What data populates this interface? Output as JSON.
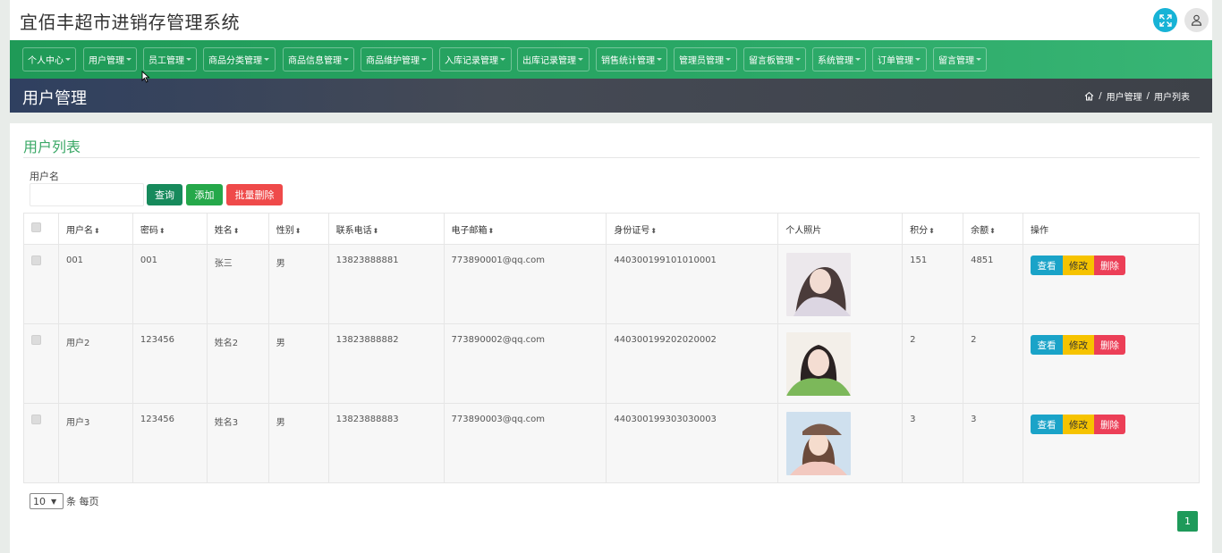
{
  "app": {
    "title": "宜佰丰超市进销存管理系统"
  },
  "nav": [
    {
      "label": "个人中心"
    },
    {
      "label": "用户管理"
    },
    {
      "label": "员工管理"
    },
    {
      "label": "商品分类管理"
    },
    {
      "label": "商品信息管理"
    },
    {
      "label": "商品维护管理"
    },
    {
      "label": "入库记录管理"
    },
    {
      "label": "出库记录管理"
    },
    {
      "label": "销售统计管理"
    },
    {
      "label": "管理员管理"
    },
    {
      "label": "留言板管理"
    },
    {
      "label": "系统管理"
    },
    {
      "label": "订单管理"
    },
    {
      "label": "留言管理"
    }
  ],
  "banner": {
    "title": "用户管理",
    "crumb1": "用户管理",
    "crumb2": "用户列表",
    "sep": "/"
  },
  "panel": {
    "title": "用户列表"
  },
  "search": {
    "label": "用户名",
    "value": "",
    "placeholder": "",
    "query_btn": "查询",
    "add_btn": "添加",
    "batch_delete_btn": "批量删除"
  },
  "table": {
    "headers": {
      "username": "用户名",
      "password": "密码",
      "name": "姓名",
      "gender": "性别",
      "phone": "联系电话",
      "email": "电子邮箱",
      "idcard": "身份证号",
      "photo": "个人照片",
      "points": "积分",
      "balance": "余额",
      "action": "操作"
    },
    "rows": [
      {
        "username": "001",
        "password": "001",
        "name": "张三",
        "gender": "男",
        "phone": "13823888881",
        "email": "773890001@qq.com",
        "idcard": "440300199101010001",
        "points": "151",
        "balance": "4851"
      },
      {
        "username": "用户2",
        "password": "123456",
        "name": "姓名2",
        "gender": "男",
        "phone": "13823888882",
        "email": "773890002@qq.com",
        "idcard": "440300199202020002",
        "points": "2",
        "balance": "2"
      },
      {
        "username": "用户3",
        "password": "123456",
        "name": "姓名3",
        "gender": "男",
        "phone": "13823888883",
        "email": "773890003@qq.com",
        "idcard": "440300199303030003",
        "points": "3",
        "balance": "3"
      }
    ],
    "actions": {
      "view": "查看",
      "edit": "修改",
      "delete": "删除"
    }
  },
  "pagination": {
    "page_size": "10",
    "per_page_label": "条 每页",
    "current_page": "1"
  },
  "colors": {
    "brand_green": "#2aa866",
    "view": "#1aa3c8",
    "edit": "#f6c300",
    "delete": "#ec3f57",
    "expand": "#17b3d6"
  },
  "icons": [
    "expand-icon",
    "user-icon",
    "home-icon",
    "sort-icon",
    "caret-down-icon",
    "cursor-icon"
  ]
}
